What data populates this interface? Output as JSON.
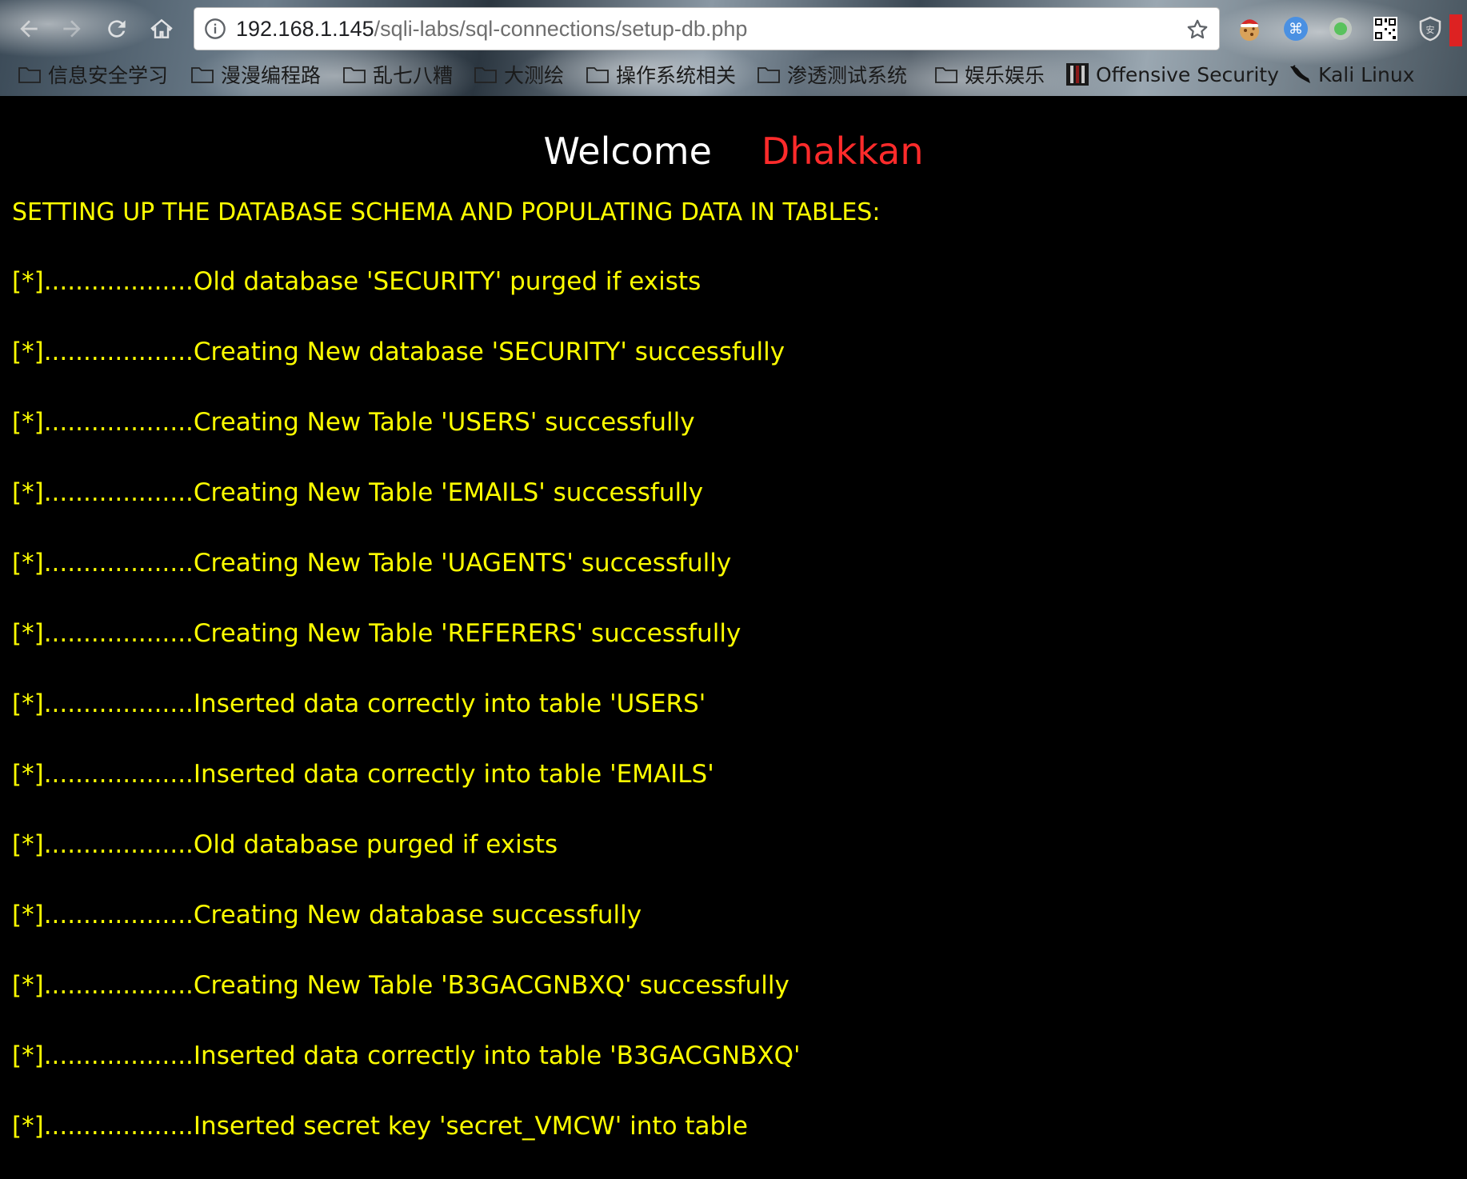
{
  "browser": {
    "url_host": "192.168.1.145",
    "url_path": "/sqli-labs/sql-connections/setup-db.php",
    "bookmarks": [
      {
        "label": "信息安全学习",
        "icon": "folder-icon"
      },
      {
        "label": "漫漫编程路",
        "icon": "folder-icon"
      },
      {
        "label": "乱七八糟",
        "icon": "folder-icon"
      },
      {
        "label": "大测绘",
        "icon": "folder-icon"
      },
      {
        "label": "操作系统相关",
        "icon": "folder-icon"
      },
      {
        "label": "渗透测试系统",
        "icon": "folder-icon"
      },
      {
        "label": "娱乐娱乐",
        "icon": "folder-icon"
      },
      {
        "label": "Offensive Security",
        "icon": "offsec-icon"
      },
      {
        "label": "Kali Linux",
        "icon": "kali-dragon-icon"
      }
    ],
    "extensions": [
      "santa-cookie-icon",
      "command-key-icon",
      "green-circle-icon",
      "qr-code-icon",
      "shield-icon"
    ]
  },
  "page": {
    "welcome_text": "Welcome",
    "user_name": "Dhakkan",
    "heading": "SETTING UP THE DATABASE SCHEMA AND POPULATING DATA IN TABLES:",
    "log_lines": [
      "[*]...................Old database 'SECURITY' purged if exists",
      "[*]...................Creating New database 'SECURITY' successfully",
      "[*]...................Creating New Table 'USERS' successfully",
      "[*]...................Creating New Table 'EMAILS' successfully",
      "[*]...................Creating New Table 'UAGENTS' successfully",
      "[*]...................Creating New Table 'REFERERS' successfully",
      "[*]...................Inserted data correctly into table 'USERS'",
      "[*]...................Inserted data correctly into table 'EMAILS'",
      "[*]...................Old database purged if exists",
      "[*]...................Creating New database successfully",
      "[*]...................Creating New Table 'B3GACGNBXQ' successfully",
      "[*]...................Inserted data correctly into table 'B3GACGNBXQ'",
      "[*]...................Inserted secret key 'secret_VMCW' into table"
    ]
  },
  "colors": {
    "text_yellow": "#ffff00",
    "name_red": "#ff2b2b",
    "welcome_white": "#ffffff",
    "background": "#000000"
  }
}
